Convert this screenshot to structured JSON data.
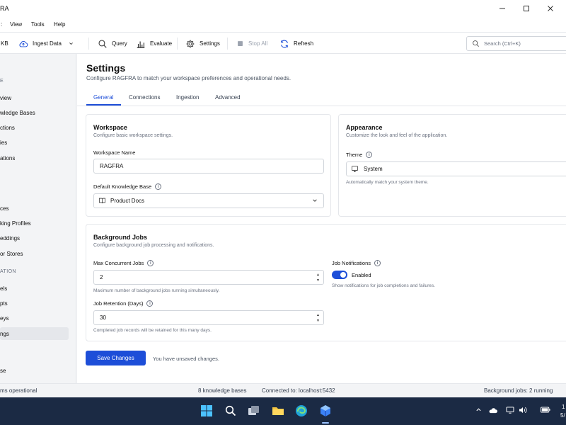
{
  "window": {
    "title": "RA",
    "controls": [
      "minimize",
      "maximize",
      "close"
    ]
  },
  "menu": [
    "View",
    "Tools",
    "Help"
  ],
  "toolbar": {
    "new_kb_label": "KB",
    "ingest_label": "Ingest Data",
    "query_label": "Query",
    "evaluate_label": "Evaluate",
    "settings_label": "Settings",
    "stop_all_label": "Stop All",
    "refresh_label": "Refresh",
    "search_placeholder": "Search (Ctrl+K)"
  },
  "sidebar": {
    "section_1": "E",
    "items_1": [
      "view",
      "wledge Bases",
      "ctions",
      "ies",
      "ations"
    ],
    "items_2": [
      "ces",
      "king Profiles",
      "eddings",
      "or Stores"
    ],
    "section_2": "ATION",
    "items_3": [
      "els",
      "pts",
      "eys",
      "ngs"
    ],
    "footer": "se"
  },
  "page": {
    "title": "Settings",
    "subtitle": "Configure RAGFRA to match your workspace preferences and operational needs.",
    "tabs": [
      "General",
      "Connections",
      "Ingestion",
      "Advanced"
    ],
    "active_tab": "General"
  },
  "workspace": {
    "title": "Workspace",
    "desc": "Configure basic workspace settings.",
    "name_label": "Workspace Name",
    "name_value": "RAGFRA",
    "default_kb_label": "Default Knowledge Base",
    "default_kb_value": "Product Docs"
  },
  "appearance": {
    "title": "Appearance",
    "desc": "Customize the look and feel of the application.",
    "theme_label": "Theme",
    "theme_value": "System",
    "theme_help": "Automatically match your system theme."
  },
  "jobs": {
    "title": "Background Jobs",
    "desc": "Configure background job processing and notifications.",
    "max_label": "Max Concurrent Jobs",
    "max_value": "2",
    "max_help": "Maximum number of background jobs running simultaneously.",
    "retention_label": "Job Retention (Days)",
    "retention_value": "30",
    "retention_help": "Completed job records will be retained for this many days.",
    "notif_label": "Job Notifications",
    "notif_state": "Enabled",
    "notif_help": "Show notifications for job completions and failures."
  },
  "actions": {
    "save_label": "Save Changes",
    "unsaved_text": "You have unsaved changes."
  },
  "status": {
    "system": "ms operational",
    "kb_count": "8 knowledge bases",
    "connection": "Connected to: localhost:5432",
    "jobs": "Background jobs: 2 running"
  },
  "taskbar": {
    "clock_top": "1",
    "clock_bottom": "5/"
  },
  "colors": {
    "accent": "#1d4ed8",
    "taskbar": "#1b2a44"
  }
}
